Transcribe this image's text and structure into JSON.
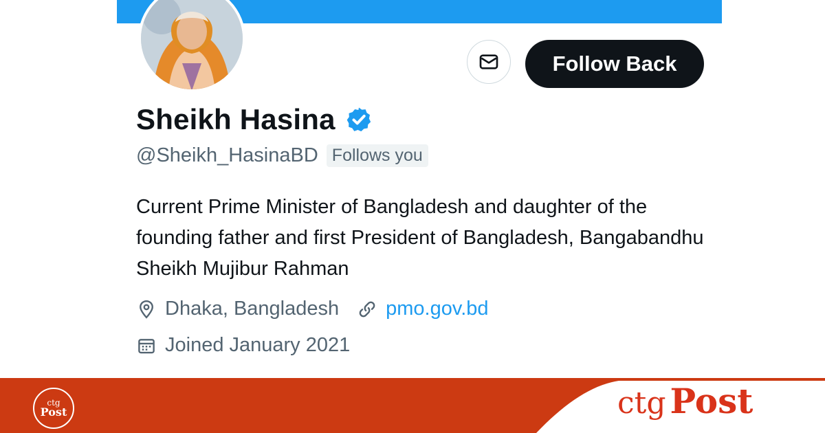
{
  "profile": {
    "name": "Sheikh Hasina",
    "handle": "@Sheikh_HasinaBD",
    "follows_you": "Follows you",
    "bio": "Current Prime Minister of Bangladesh and daughter of the founding father and first President of Bangladesh, Bangabandhu Sheikh Mujibur Rahman",
    "location": "Dhaka, Bangladesh",
    "website": "pmo.gov.bd",
    "joined": "Joined January 2021"
  },
  "actions": {
    "follow_back_label": "Follow Back",
    "message_icon": "envelope-icon"
  },
  "icons": {
    "verified": "verified-badge-icon",
    "location": "location-pin-icon",
    "link": "link-icon",
    "calendar": "calendar-icon"
  },
  "branding": {
    "small_logo_top": "ctg",
    "small_logo_bottom": "Post",
    "logo_part1": "ctg",
    "logo_part2": "Post"
  },
  "colors": {
    "accent": "#1d9bf0",
    "button_dark": "#0f1419",
    "text_secondary": "#536471",
    "brand_red": "#d9331a"
  }
}
